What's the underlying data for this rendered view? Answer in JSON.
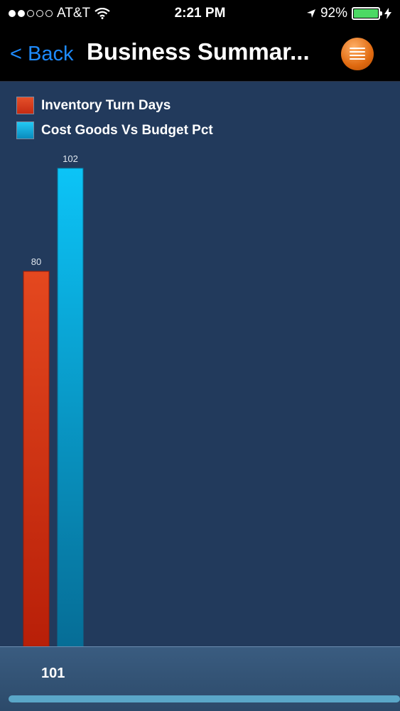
{
  "status_bar": {
    "carrier": "AT&T",
    "time": "2:21 PM",
    "battery": "92%",
    "signal_bars": 2
  },
  "nav": {
    "back_label": "< Back",
    "title": "Business Summar...",
    "menu_icon": "list-icon"
  },
  "colors": {
    "red": "#d9391a",
    "blue": "#11a7da",
    "background": "#223a5c",
    "accent": "#1e8bff"
  },
  "chart_data": {
    "type": "bar",
    "categories": [
      "101"
    ],
    "series": [
      {
        "name": "Inventory Turn Days",
        "values": [
          80
        ]
      },
      {
        "name": "Cost Goods Vs Budget Pct",
        "values": [
          102
        ]
      }
    ],
    "ylim": [
      0,
      120
    ],
    "legend": "top-left",
    "grid": false
  },
  "footer": {
    "selected_category": "101"
  }
}
